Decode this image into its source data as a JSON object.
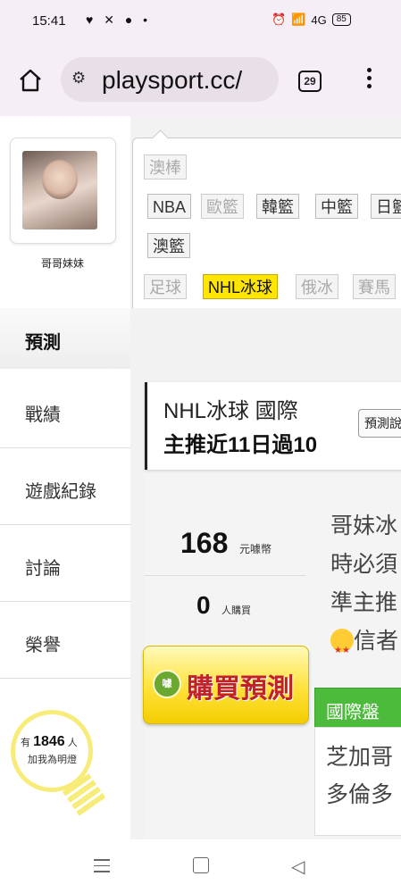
{
  "status_bar": {
    "time": "15:41",
    "left_icons": "♥ ✕ ● •",
    "network": "4G",
    "battery": "85"
  },
  "browser": {
    "url": "playsport.cc/",
    "tab_count": "29"
  },
  "profile": {
    "name": "哥哥妹妹"
  },
  "nav": {
    "items": [
      {
        "label": "預測",
        "active": true
      },
      {
        "label": "戰績"
      },
      {
        "label": "遊戲紀錄"
      },
      {
        "label": "討論"
      },
      {
        "label": "榮譽"
      }
    ]
  },
  "fans": {
    "prefix": "有",
    "count": "1846",
    "suffix": "人",
    "line2": "加我為明燈"
  },
  "filters": {
    "row1": [
      "澳棒"
    ],
    "row2": [
      "NBA",
      "歐籃",
      "韓籃",
      "中籃",
      "日籃"
    ],
    "row3": [
      "澳籃"
    ],
    "row4": [
      "足球",
      "NHL冰球",
      "俄冰",
      "賽馬"
    ]
  },
  "recommendation": {
    "title": "NHL冰球 國際",
    "summary": "主推近11日過10",
    "button": "預測說"
  },
  "sale": {
    "price": "168",
    "price_unit": "元噱幣",
    "buyers": "0",
    "buyers_unit": "人購買",
    "buy_icon": "噱",
    "buy_label": "購買預測"
  },
  "description": {
    "line1": "哥妹冰",
    "line2": "時必須",
    "line3": "準主推",
    "line4": "信者"
  },
  "pick": {
    "tab": "國際盤",
    "line1": "芝加哥",
    "line2": "多倫多"
  }
}
